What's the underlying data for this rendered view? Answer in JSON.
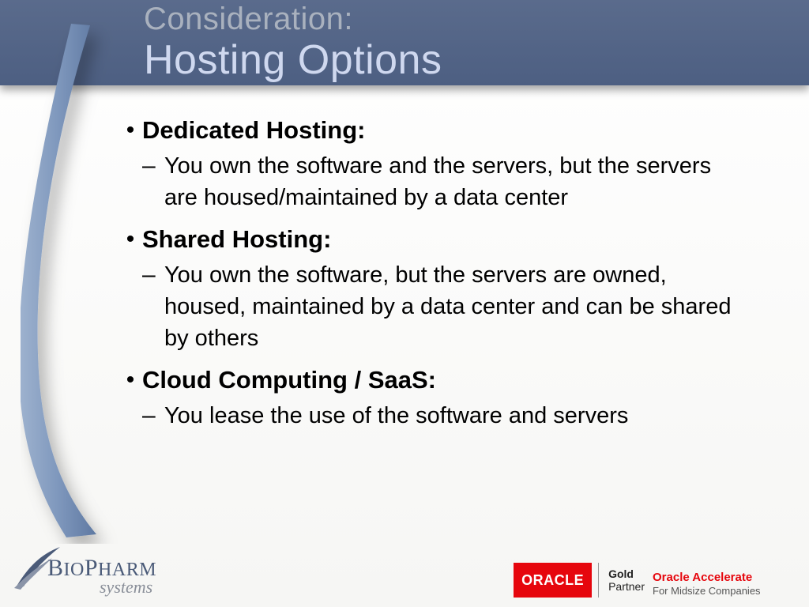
{
  "header": {
    "pretitle": "Consideration:",
    "title": "Hosting Options"
  },
  "bullets": [
    {
      "title": "Dedicated Hosting:",
      "sub": "You own the software and the servers, but the servers are housed/maintained by a data center"
    },
    {
      "title": "Shared Hosting:",
      "sub": "You own the software, but the servers are owned, housed, maintained by a data center and can be shared by others"
    },
    {
      "title": "Cloud Computing / SaaS:",
      "sub": "You lease the use of the software and servers"
    }
  ],
  "footer": {
    "biopharm_line1": "BIOPHARM",
    "biopharm_line2": "systems",
    "oracle_brand": "ORACLE",
    "partner_level": "Gold",
    "partner_label": "Partner",
    "accelerate_title": "Oracle Accelerate",
    "accelerate_sub": "For Midsize Companies"
  }
}
